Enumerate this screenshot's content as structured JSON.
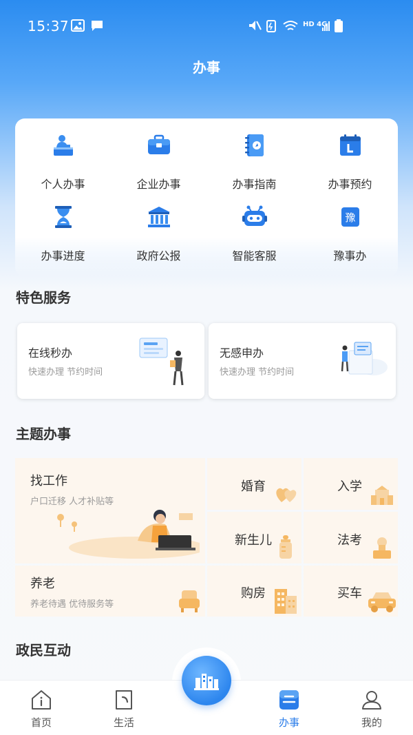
{
  "status_bar": {
    "time": "15:37",
    "network": "HD 4G"
  },
  "header": {
    "title": "办事"
  },
  "services": [
    {
      "label": "个人办事",
      "icon": "person-desk-icon"
    },
    {
      "label": "企业办事",
      "icon": "briefcase-icon"
    },
    {
      "label": "办事指南",
      "icon": "guide-book-icon"
    },
    {
      "label": "办事预约",
      "icon": "calendar-icon"
    },
    {
      "label": "办事进度",
      "icon": "hourglass-icon"
    },
    {
      "label": "政府公报",
      "icon": "government-building-icon"
    },
    {
      "label": "智能客服",
      "icon": "robot-icon"
    },
    {
      "label": "豫事办",
      "icon": "yu-badge-icon",
      "badge_text": "豫"
    }
  ],
  "featured": {
    "title": "特色服务",
    "cards": [
      {
        "title": "在线秒办",
        "subtitle": "快速办理 节约时间"
      },
      {
        "title": "无感申办",
        "subtitle": "快速办理 节约时间"
      }
    ]
  },
  "themes": {
    "title": "主题办事",
    "job": {
      "title": "找工作",
      "subtitle": "户口迁移 人才补贴等"
    },
    "elderly": {
      "title": "养老",
      "subtitle": "养老待遇 优待服务等"
    },
    "small": [
      "婚育",
      "入学",
      "新生儿",
      "法考",
      "购房",
      "买车"
    ]
  },
  "interaction": {
    "title": "政民互动"
  },
  "bottom_nav": [
    {
      "label": "首页",
      "icon": "home-icon"
    },
    {
      "label": "生活",
      "icon": "life-icon"
    },
    {
      "label": "办事",
      "icon": "affairs-icon",
      "active": true
    },
    {
      "label": "我的",
      "icon": "profile-icon"
    }
  ],
  "colors": {
    "primary": "#2b7de9",
    "theme_bg": "#fdf6ee",
    "accent_orange": "#f5b761"
  }
}
